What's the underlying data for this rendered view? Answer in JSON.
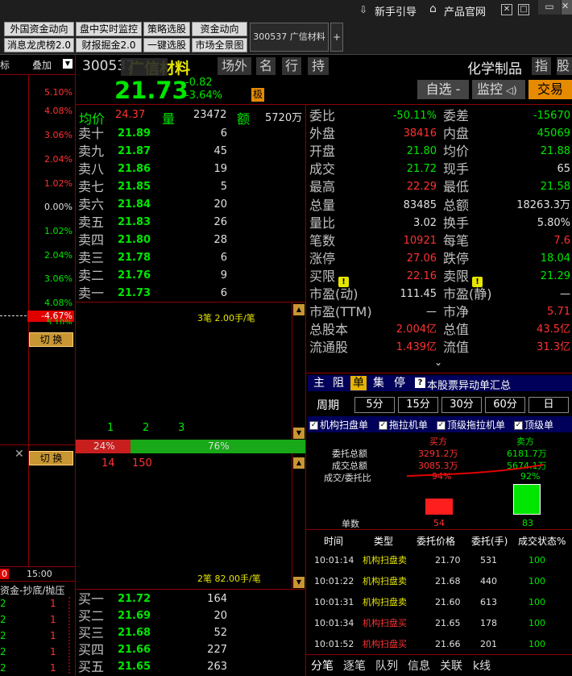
{
  "topbar": {
    "guide": "新手引导",
    "official": "产品官网"
  },
  "tabs_row1": [
    "外国资金动向",
    "盘中实时监控",
    "策略选股",
    "资金动向"
  ],
  "tabs_row2": [
    "消息龙虎榜2.0",
    "财报掘金2.0",
    "一键选股",
    "市场全景图"
  ],
  "stock_tab": "300537 广信材料",
  "plus": "+",
  "left_header": {
    "col1": "标",
    "col2": "叠加"
  },
  "left_pcts": [
    "5.10%",
    "4.08%",
    "3.06%",
    "2.04%",
    "1.02%",
    "0.00%",
    "1.02%",
    "2.04%",
    "3.06%",
    "4.08%"
  ],
  "left_marker": "-4.67%",
  "left_marker2": "5.10%",
  "switch_label": "切 换",
  "left_time": {
    "a": "0",
    "b": "15:00"
  },
  "left_bottom_title": "资金-抄底/抛压",
  "left_bottom_rows": [
    [
      "2",
      "1"
    ],
    [
      "2",
      "1"
    ],
    [
      "2",
      "1"
    ],
    [
      "2",
      "1"
    ],
    [
      "2",
      "1"
    ]
  ],
  "header": {
    "code": "300537",
    "name": "广信材料",
    "btn1": "场外",
    "btn2": "名",
    "btn3": "行",
    "btn4": "持",
    "industry": "化学制品",
    "idx": "指",
    "stock": "股",
    "price": "21.73",
    "change": "-0.82",
    "pct": "-3.64%",
    "tag": "极",
    "watch": "自选 -",
    "monitor": "监控",
    "trade": "交易"
  },
  "summary": {
    "avg_label": "均价",
    "avg": "24.37",
    "vol_label": "量",
    "vol": "23472",
    "amt_label": "额",
    "amt": "5720万"
  },
  "asks": [
    [
      "卖十",
      "21.89",
      "6"
    ],
    [
      "卖九",
      "21.87",
      "45"
    ],
    [
      "卖八",
      "21.86",
      "19"
    ],
    [
      "卖七",
      "21.85",
      "5"
    ],
    [
      "卖六",
      "21.84",
      "20"
    ],
    [
      "卖五",
      "21.83",
      "26"
    ],
    [
      "卖四",
      "21.80",
      "28"
    ],
    [
      "卖三",
      "21.78",
      "6"
    ],
    [
      "卖二",
      "21.76",
      "9"
    ],
    [
      "卖一",
      "21.73",
      "6"
    ]
  ],
  "ask_note": "3笔 2.00手/笔",
  "mid_nums": [
    "1",
    "2",
    "3"
  ],
  "bar": {
    "left_pct": "24%",
    "right_pct": "76%",
    "sell_share": 0.24
  },
  "bar_nums": [
    "14",
    "150"
  ],
  "bid_note": "2笔 82.00手/笔",
  "bids": [
    [
      "买一",
      "21.72",
      "164"
    ],
    [
      "买二",
      "21.69",
      "20"
    ],
    [
      "买三",
      "21.68",
      "52"
    ],
    [
      "买四",
      "21.66",
      "227"
    ],
    [
      "买五",
      "21.65",
      "263"
    ]
  ],
  "stats": [
    [
      "委比",
      "-50.11%",
      "g",
      "委差",
      "-15670",
      "g"
    ],
    [
      "外盘",
      "38416",
      "r",
      "内盘",
      "45069",
      "g"
    ],
    [
      "开盘",
      "21.80",
      "g",
      "均价",
      "21.88",
      "g"
    ],
    [
      "成交",
      "21.72",
      "g",
      "现手",
      "65",
      "w"
    ],
    [
      "最高",
      "22.29",
      "r",
      "最低",
      "21.58",
      "g"
    ],
    [
      "总量",
      "83485",
      "w",
      "总额",
      "18263.3万",
      "w"
    ],
    [
      "量比",
      "3.02",
      "w",
      "换手",
      "5.80%",
      "w"
    ],
    [
      "笔数",
      "10921",
      "r",
      "每笔",
      "7.6",
      "r"
    ],
    [
      "涨停",
      "27.06",
      "r",
      "跌停",
      "18.04",
      "g"
    ],
    [
      "买限",
      "22.16",
      "r",
      "卖限",
      "21.29",
      "g"
    ],
    [
      "市盈(动)",
      "111.45",
      "w",
      "市盈(静)",
      "—",
      "w"
    ],
    [
      "市盈(TTM)",
      "—",
      "w",
      "市净",
      "5.71",
      "r"
    ],
    [
      "总股本",
      "2.004亿",
      "r",
      "总值",
      "43.5亿",
      "r"
    ],
    [
      "流通股",
      "1.439亿",
      "r",
      "流值",
      "31.3亿",
      "r"
    ]
  ],
  "right_tabs": [
    "主",
    "阻",
    "单",
    "集",
    "停"
  ],
  "right_tab_title": "本股票异动单汇总",
  "period_label": "周期",
  "periods": [
    "5分",
    "15分",
    "30分",
    "60分",
    "日"
  ],
  "checkboxes": [
    "机构扫盘单",
    "拖拉机单",
    "顶级拖拉机单",
    "顶级单"
  ],
  "compare": {
    "buy_label": "买方",
    "sell_label": "卖方",
    "row1": "委托总额",
    "row2": "成交总额",
    "row3": "成交/委托比",
    "buy1": "3291.2万",
    "buy2": "3085.3万",
    "buy3": "94%",
    "sell1": "6181.7万",
    "sell2": "5674.1万",
    "sell3": "92%",
    "count_label": "单数",
    "buy_count": "54",
    "sell_count": "83"
  },
  "trade_head": [
    "时间",
    "类型",
    "委托价格",
    "委托(手)",
    "成交状态%"
  ],
  "trades": [
    [
      "10:01:14",
      "机构扫盘卖",
      "21.70",
      "531",
      "100",
      "g"
    ],
    [
      "10:01:22",
      "机构扫盘卖",
      "21.68",
      "440",
      "100",
      "g"
    ],
    [
      "10:01:31",
      "机构扫盘卖",
      "21.60",
      "613",
      "100",
      "g"
    ],
    [
      "10:01:34",
      "机构扫盘买",
      "21.65",
      "178",
      "100",
      "r"
    ],
    [
      "10:01:52",
      "机构扫盘买",
      "21.66",
      "201",
      "100",
      "r"
    ]
  ],
  "bottom_tabs": [
    "分笔",
    "逐笔",
    "队列",
    "信息",
    "关联",
    "k线"
  ]
}
